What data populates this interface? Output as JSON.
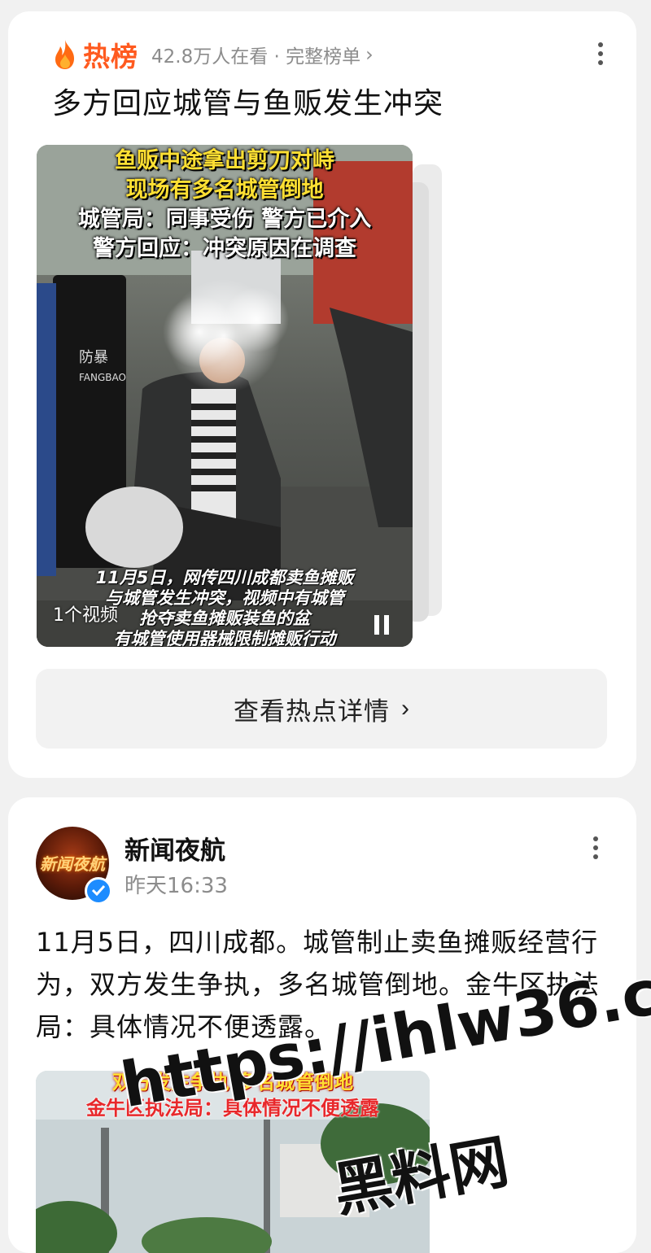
{
  "trending_card": {
    "brand_label": "热榜",
    "meta": "42.8万人在看 · 完整榜单",
    "headline": "多方回应城管与鱼贩发生冲突",
    "video": {
      "overlay_top": [
        "鱼贩中途拿出剪刀对峙",
        "现场有多名城管倒地",
        "城管局：同事受伤 警方已介入",
        "警方回应：冲突原因在调查"
      ],
      "overlay_bottom": [
        "11月5日，网传四川成都卖鱼摊贩",
        "与城管发生冲突，视频中有城管",
        "抢夺卖鱼摊贩装鱼的盆",
        "有城管使用器械限制摊贩行动"
      ],
      "count_label": "1个视频",
      "shield_text": [
        "防暴",
        "FANGBAO"
      ]
    },
    "detail_button": "查看热点详情"
  },
  "post_card": {
    "author": "新闻夜航",
    "avatar_text": "新闻夜航",
    "time": "昨天16:33",
    "text": "11月5日，四川成都。城管制止卖鱼摊贩经营行为，双方发生争执，多名城管倒地。金牛区执法局：具体情况不便透露。",
    "image_caption_top": "双方发生争执 多名城管倒地",
    "image_caption_line2": "金牛区执法局：具体情况不便透露"
  },
  "watermark": {
    "url": "https://ihlw36.com",
    "name": "黑料网"
  },
  "colors": {
    "accent": "#ff5a1f",
    "meta_gray": "#8c8c8c",
    "verified_blue": "#1d8cff",
    "card_bg": "#ffffff",
    "page_bg": "#f1f1f1"
  }
}
